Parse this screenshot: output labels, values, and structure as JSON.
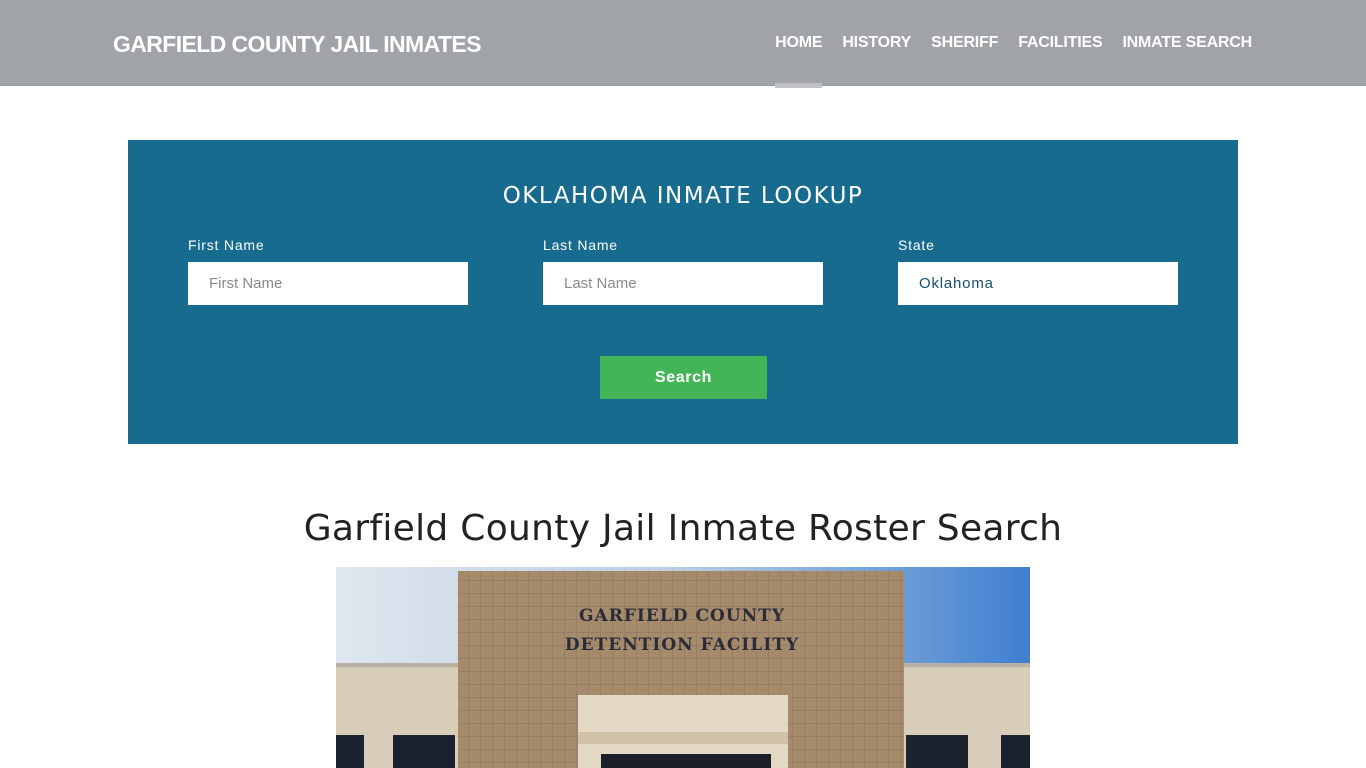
{
  "header": {
    "brand": "GARFIELD COUNTY JAIL INMATES",
    "nav": [
      {
        "label": "HOME",
        "active": true
      },
      {
        "label": "HISTORY"
      },
      {
        "label": "SHERIFF"
      },
      {
        "label": "FACILITIES"
      },
      {
        "label": "INMATE SEARCH"
      }
    ]
  },
  "lookup": {
    "title": "OKLAHOMA INMATE LOOKUP",
    "first_name": {
      "label": "First Name",
      "placeholder": "First Name"
    },
    "last_name": {
      "label": "Last Name",
      "placeholder": "Last Name"
    },
    "state": {
      "label": "State",
      "value": "Oklahoma"
    },
    "search_label": "Search"
  },
  "main": {
    "title": "Garfield County Jail Inmate Roster Search",
    "photo_sign": [
      "GARFIELD COUNTY",
      "DETENTION FACILITY"
    ]
  },
  "colors": {
    "header": "#a0a4a7",
    "panel": "#176b8e",
    "button": "#44b556"
  }
}
